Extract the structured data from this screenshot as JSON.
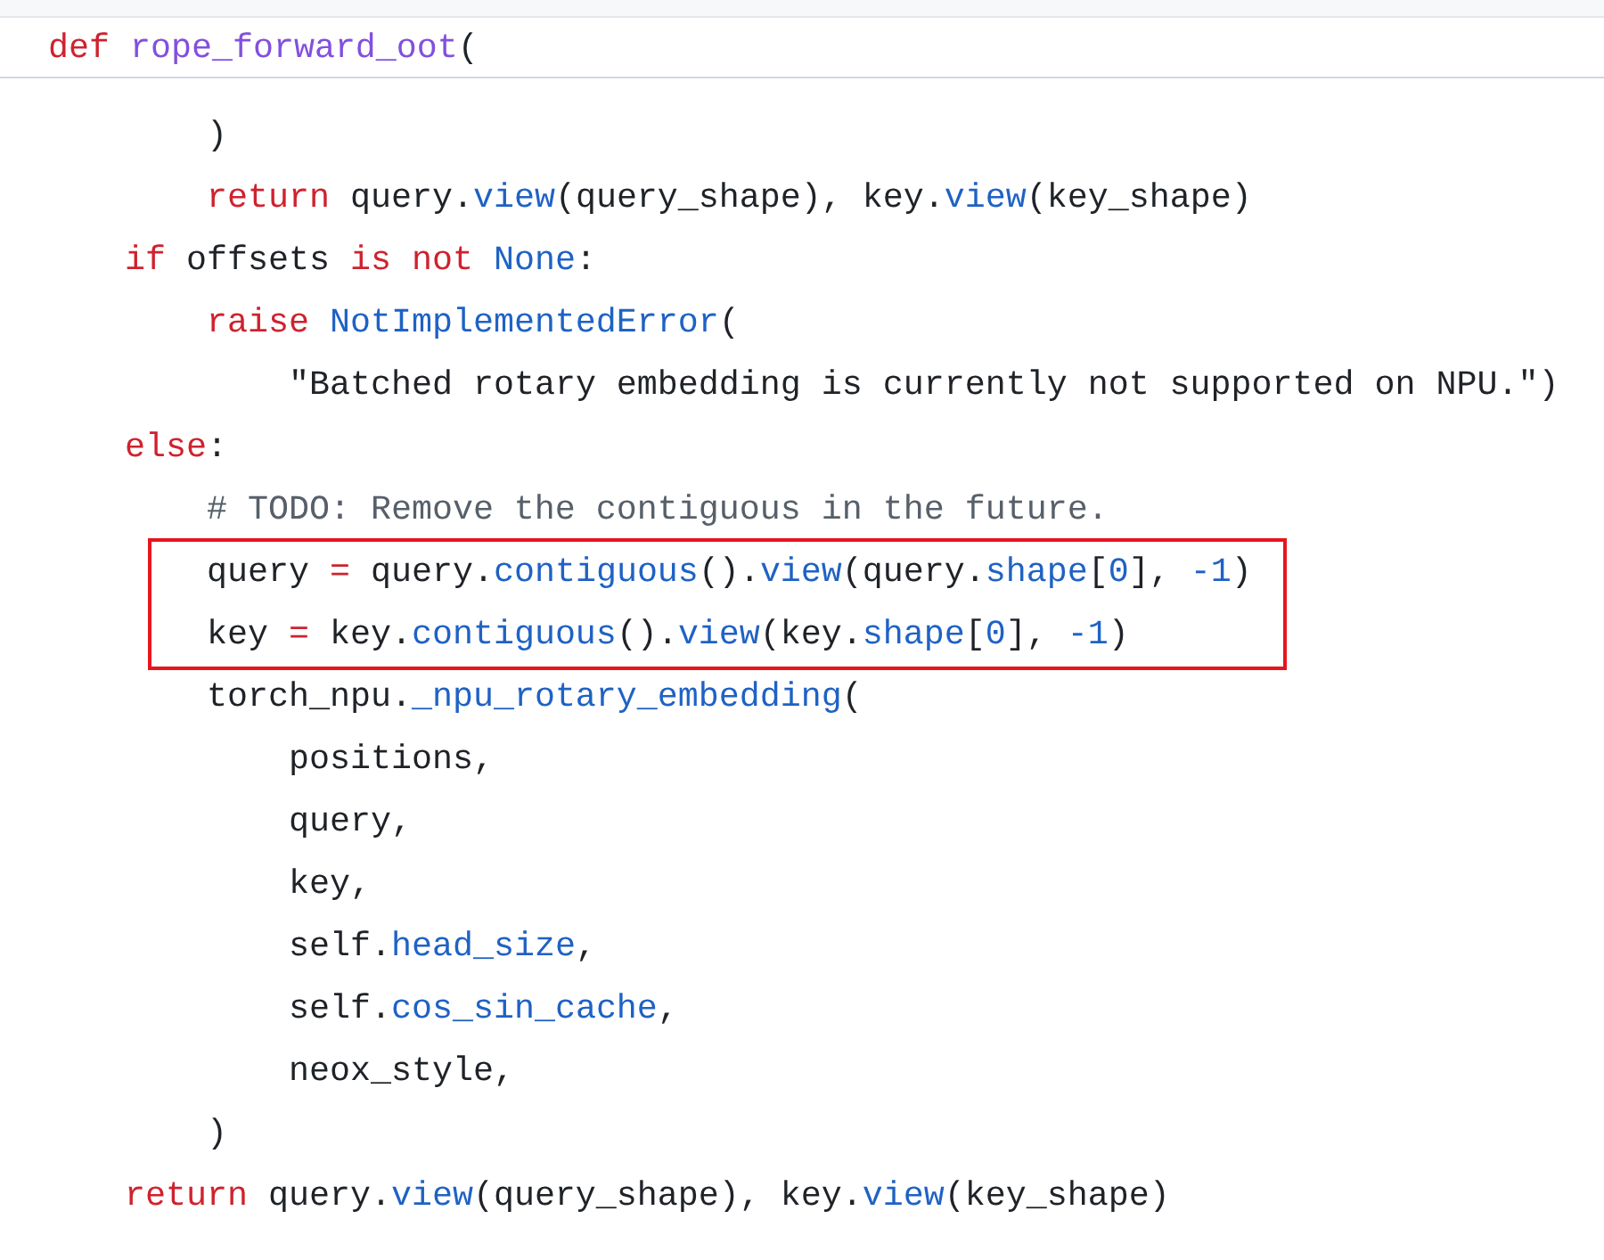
{
  "header": {
    "tokens": [
      {
        "kind": "keyword",
        "text": "def "
      },
      {
        "kind": "function",
        "text": "rope_forward_oot"
      },
      {
        "kind": "plain",
        "text": "("
      }
    ]
  },
  "lines": [
    {
      "children": [
        {
          "highlighted": false,
          "tokens": [
            {
              "kind": "plain",
              "text": ")"
            }
          ]
        },
        {
          "highlighted": false,
          "tokens": [
            {
              "kind": "keyword",
              "text": "return"
            },
            {
              "kind": "plain",
              "text": " query."
            },
            {
              "kind": "method",
              "text": "view"
            },
            {
              "kind": "plain",
              "text": "(query_shape), key."
            },
            {
              "kind": "method",
              "text": "view"
            },
            {
              "kind": "plain",
              "text": "(key_shape)"
            }
          ]
        }
      ]
    },
    {
      "highlighted": false,
      "tokens": [
        {
          "kind": "keyword",
          "text": "if"
        },
        {
          "kind": "plain",
          "text": " offsets "
        },
        {
          "kind": "keyword",
          "text": "is not "
        },
        {
          "kind": "constant",
          "text": "None"
        },
        {
          "kind": "plain",
          "text": ":"
        }
      ],
      "children": [
        {
          "highlighted": false,
          "tokens": [
            {
              "kind": "keyword",
              "text": "raise "
            },
            {
              "kind": "method",
              "text": "NotImplementedError"
            },
            {
              "kind": "plain",
              "text": "("
            }
          ],
          "children": [
            {
              "highlighted": false,
              "tokens": [
                {
                  "kind": "string",
                  "text": "\"Batched rotary embedding is currently not supported on NPU.\""
                },
                {
                  "kind": "plain",
                  "text": ")"
                }
              ]
            }
          ]
        }
      ]
    },
    {
      "highlighted": false,
      "tokens": [
        {
          "kind": "keyword",
          "text": "else"
        },
        {
          "kind": "plain",
          "text": ":"
        }
      ],
      "children": [
        {
          "highlighted": false,
          "tokens": [
            {
              "kind": "comment",
              "text": "# TODO: Remove the contiguous in the future."
            }
          ]
        },
        {
          "highlighted": true,
          "tokens": [
            {
              "kind": "plain",
              "text": "query "
            },
            {
              "kind": "keyword",
              "text": "="
            },
            {
              "kind": "plain",
              "text": " query."
            },
            {
              "kind": "method",
              "text": "contiguous"
            },
            {
              "kind": "plain",
              "text": "()."
            },
            {
              "kind": "method",
              "text": "view"
            },
            {
              "kind": "plain",
              "text": "(query."
            },
            {
              "kind": "method",
              "text": "shape"
            },
            {
              "kind": "plain",
              "text": "["
            },
            {
              "kind": "constant",
              "text": "0"
            },
            {
              "kind": "plain",
              "text": "], "
            },
            {
              "kind": "constant",
              "text": "-1"
            },
            {
              "kind": "plain",
              "text": ")"
            }
          ]
        },
        {
          "highlighted": true,
          "tokens": [
            {
              "kind": "plain",
              "text": "key "
            },
            {
              "kind": "keyword",
              "text": "="
            },
            {
              "kind": "plain",
              "text": " key."
            },
            {
              "kind": "method",
              "text": "contiguous"
            },
            {
              "kind": "plain",
              "text": "()."
            },
            {
              "kind": "method",
              "text": "view"
            },
            {
              "kind": "plain",
              "text": "(key."
            },
            {
              "kind": "method",
              "text": "shape"
            },
            {
              "kind": "plain",
              "text": "["
            },
            {
              "kind": "constant",
              "text": "0"
            },
            {
              "kind": "plain",
              "text": "], "
            },
            {
              "kind": "constant",
              "text": "-1"
            },
            {
              "kind": "plain",
              "text": ")"
            }
          ]
        },
        {
          "highlighted": false,
          "tokens": [
            {
              "kind": "plain",
              "text": "torch_npu."
            },
            {
              "kind": "method",
              "text": "_npu_rotary_embedding"
            },
            {
              "kind": "plain",
              "text": "("
            }
          ],
          "children": [
            {
              "highlighted": false,
              "tokens": [
                {
                  "kind": "plain",
                  "text": "positions,"
                }
              ]
            },
            {
              "highlighted": false,
              "tokens": [
                {
                  "kind": "plain",
                  "text": "query,"
                }
              ]
            },
            {
              "highlighted": false,
              "tokens": [
                {
                  "kind": "plain",
                  "text": "key,"
                }
              ]
            },
            {
              "highlighted": false,
              "tokens": [
                {
                  "kind": "plain",
                  "text": "self."
                },
                {
                  "kind": "method",
                  "text": "head_size"
                },
                {
                  "kind": "plain",
                  "text": ","
                }
              ]
            },
            {
              "highlighted": false,
              "tokens": [
                {
                  "kind": "plain",
                  "text": "self."
                },
                {
                  "kind": "method",
                  "text": "cos_sin_cache"
                },
                {
                  "kind": "plain",
                  "text": ","
                }
              ]
            },
            {
              "highlighted": false,
              "tokens": [
                {
                  "kind": "plain",
                  "text": "neox_style,"
                }
              ]
            }
          ]
        },
        {
          "highlighted": false,
          "tokens": [
            {
              "kind": "plain",
              "text": ")"
            }
          ]
        }
      ]
    },
    {
      "highlighted": false,
      "tokens": [
        {
          "kind": "keyword",
          "text": "return"
        },
        {
          "kind": "plain",
          "text": " query."
        },
        {
          "kind": "method",
          "text": "view"
        },
        {
          "kind": "plain",
          "text": "(query_shape), key."
        },
        {
          "kind": "method",
          "text": "view"
        },
        {
          "kind": "plain",
          "text": "(key_shape)"
        }
      ]
    }
  ]
}
